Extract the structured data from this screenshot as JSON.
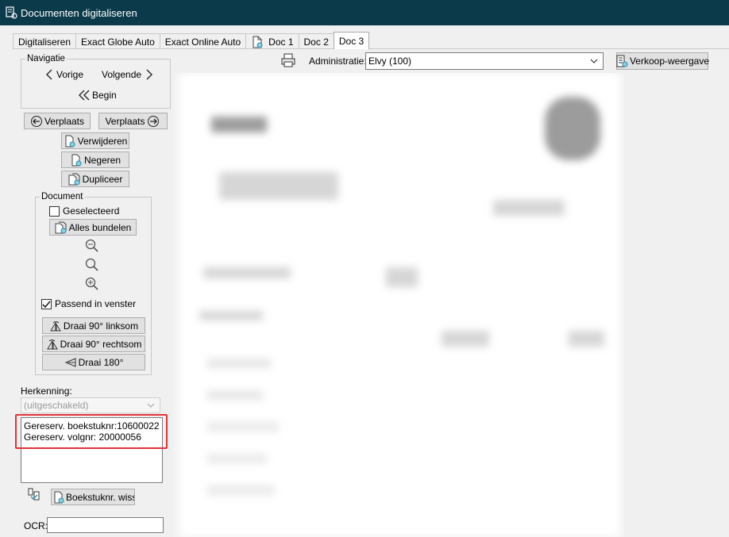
{
  "window": {
    "title": "Documenten digitaliseren"
  },
  "tabs": [
    {
      "label": "Digitaliseren"
    },
    {
      "label": "Exact Globe Auto"
    },
    {
      "label": "Exact Online Auto"
    },
    {
      "label": "Doc 1"
    },
    {
      "label": "Doc 2"
    },
    {
      "label": "Doc 3"
    }
  ],
  "navigatie": {
    "legend": "Navigatie",
    "prev": "Vorige",
    "next": "Volgende",
    "begin": "Begin"
  },
  "actions": {
    "verplaats_left": "Verplaats",
    "verplaats_right": "Verplaats",
    "verwijderen": "Verwijderen",
    "negeren": "Negeren",
    "dupliceer": "Dupliceer"
  },
  "document": {
    "legend": "Document",
    "geselecteerd": "Geselecteerd",
    "geselecteerd_checked": false,
    "alles_bundelen": "Alles bundelen",
    "passend": "Passend in venster",
    "passend_checked": true,
    "rotate_left": "Draai 90° linksom",
    "rotate_right": "Draai 90° rechtsom",
    "rotate_180": "Draai 180°"
  },
  "herkenning": {
    "label": "Herkenning:",
    "value": "(uitgeschakeld)",
    "lines": [
      "Gereserv. boekstuknr:10600022",
      "Gereserv. volgnr: 20000056"
    ],
    "wissen": "Boekstuknr. wissen"
  },
  "ocr": {
    "label": "OCR:",
    "value": ""
  },
  "toolbar": {
    "administratie_label": "Administratie:",
    "administratie_value": "Elvy (100)",
    "verkoop": "Verkoop-weergave"
  },
  "colors": {
    "titlebar": "#0b3a4b",
    "highlight": "#e0343a"
  }
}
